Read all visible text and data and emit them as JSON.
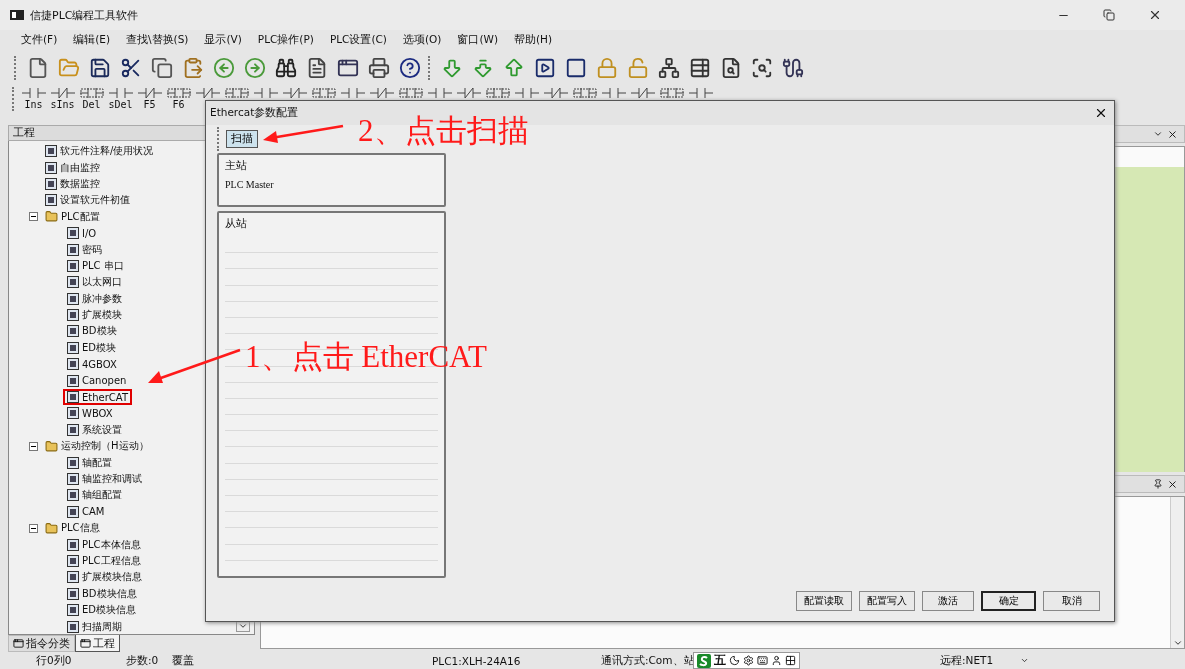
{
  "window": {
    "title": "信捷PLC编程工具软件"
  },
  "menu": [
    "文件(F)",
    "编辑(E)",
    "查找\\替换(S)",
    "显示(V)",
    "PLC操作(P)",
    "PLC设置(C)",
    "选项(O)",
    "窗口(W)",
    "帮助(H)"
  ],
  "ladder_toolbar": [
    "Ins",
    "sIns",
    "Del",
    "sDel",
    "F5",
    "F6"
  ],
  "project_panel": {
    "title": "工程",
    "tree": [
      {
        "label": "软元件注释/使用状况"
      },
      {
        "label": "自由监控"
      },
      {
        "label": "数据监控"
      },
      {
        "label": "设置软元件初值"
      },
      {
        "label": "PLC配置",
        "expanded": true,
        "children": [
          {
            "label": "I/O",
            "marked": false
          },
          {
            "label": "密码",
            "marked": false
          },
          {
            "label": "PLC 串口",
            "marked": false
          },
          {
            "label": "以太网口",
            "marked": false
          },
          {
            "label": "脉冲参数",
            "marked": false
          },
          {
            "label": "扩展模块",
            "marked": false
          },
          {
            "label": "BD模块",
            "marked": false
          },
          {
            "label": "ED模块",
            "marked": false
          },
          {
            "label": "4GBOX",
            "marked": false
          },
          {
            "label": "Canopen",
            "marked": false
          },
          {
            "label": "EtherCAT",
            "marked": true
          },
          {
            "label": "WBOX",
            "marked": false
          },
          {
            "label": "系统设置",
            "marked": false
          }
        ]
      },
      {
        "label": "运动控制（H运动）",
        "expanded": true,
        "children": [
          {
            "label": "轴配置"
          },
          {
            "label": "轴监控和调试"
          },
          {
            "label": "轴组配置"
          },
          {
            "label": "CAM"
          }
        ]
      },
      {
        "label": "PLC信息",
        "expanded": true,
        "children": [
          {
            "label": "PLC本体信息"
          },
          {
            "label": "PLC工程信息"
          },
          {
            "label": "扩展模块信息"
          },
          {
            "label": "BD模块信息"
          },
          {
            "label": "ED模块信息"
          },
          {
            "label": "扫描周期"
          }
        ]
      }
    ],
    "tabs": [
      {
        "label": "指令分类",
        "selected": false
      },
      {
        "label": "工程",
        "selected": true
      }
    ]
  },
  "dialog": {
    "title": "Ethercat参数配置",
    "scan_button": "扫描",
    "master": {
      "title": "主站",
      "items": [
        "PLC Master"
      ]
    },
    "slave": {
      "title": "从站"
    },
    "buttons": [
      {
        "label": "配置读取",
        "default": false
      },
      {
        "label": "配置写入",
        "default": false
      },
      {
        "label": "激活",
        "default": false
      },
      {
        "label": "确定",
        "default": true
      },
      {
        "label": "取消",
        "default": false
      }
    ]
  },
  "annotations": [
    {
      "text": "2、点击扫描"
    },
    {
      "text": "1、点击 EtherCAT"
    }
  ],
  "status_bar": {
    "position": "行0列0",
    "steps": "步数:0",
    "mode": "覆盖",
    "plc": "PLC1:XLH-24A16",
    "comm": "通讯方式:Com、站",
    "ime_key": "五",
    "remote": "远程:NET1"
  }
}
